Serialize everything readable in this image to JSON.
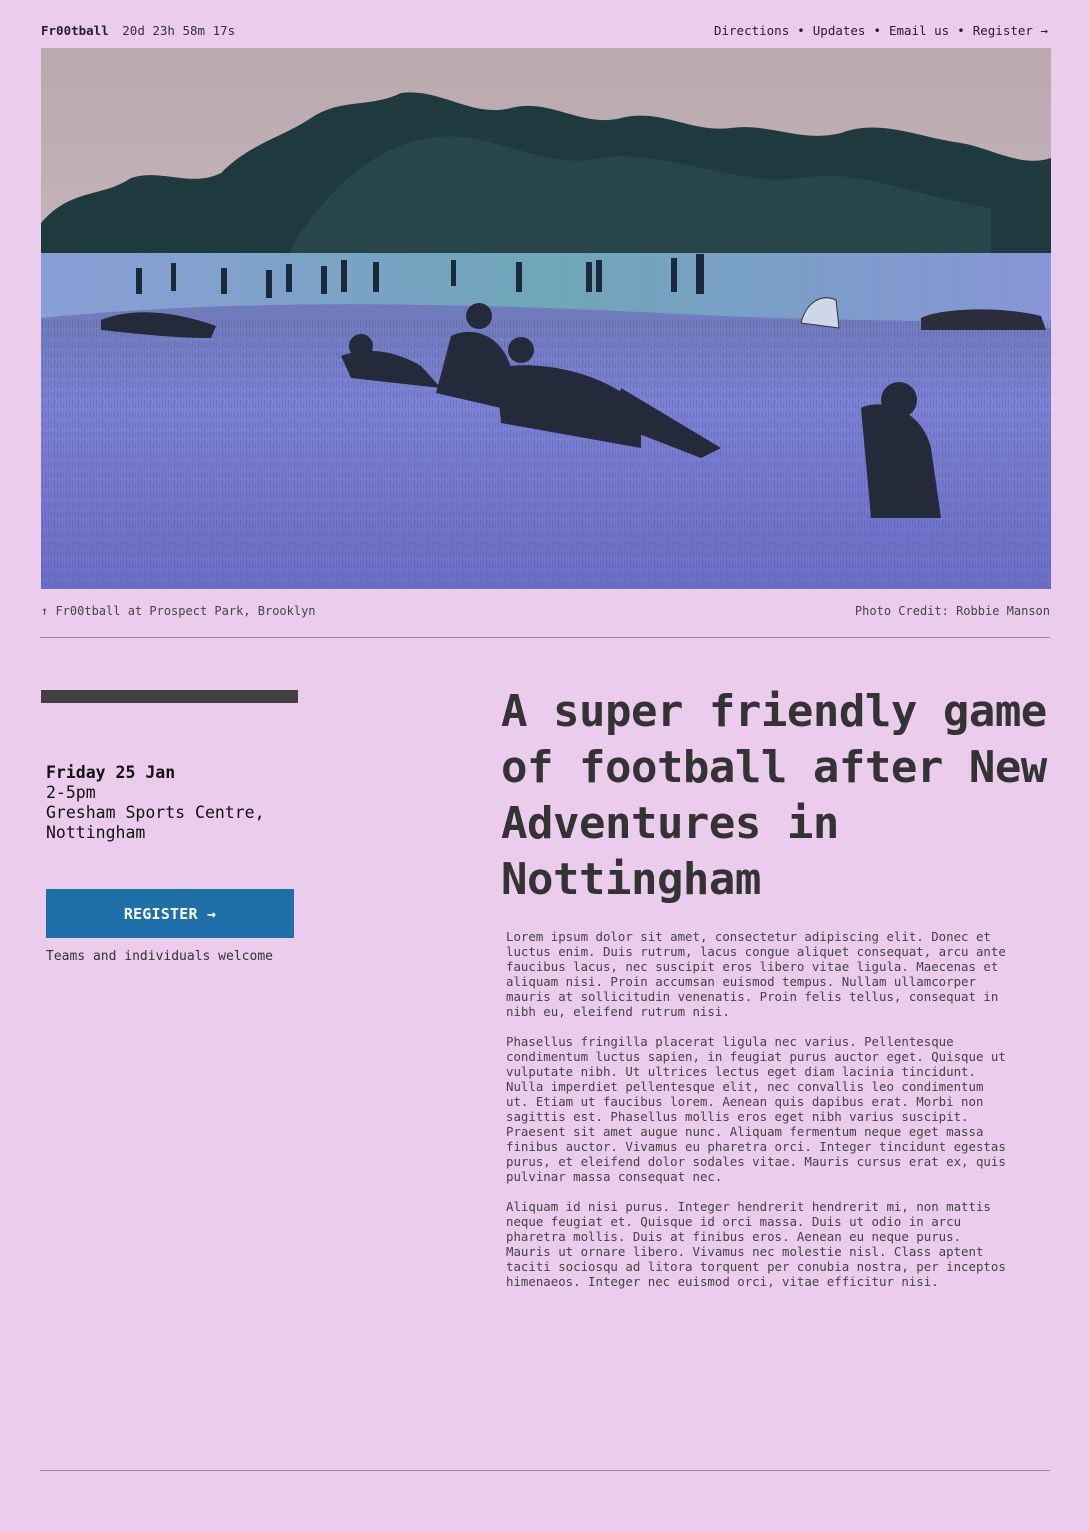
{
  "header": {
    "brand": "Fr00tball",
    "countdown": "20d 23h 58m 17s",
    "nav": [
      "Directions",
      "Updates",
      "Email us",
      "Register →"
    ],
    "separator": "•"
  },
  "hero": {
    "caption": "↑ Fr00tball at Prospect Park, Brooklyn",
    "credit": "Photo Credit: Robbie Manson"
  },
  "event": {
    "date": "Friday 25 Jan",
    "time": "2-5pm",
    "venue_line1": "Gresham Sports Centre,",
    "venue_line2": "Nottingham",
    "register_label": "REGISTER →",
    "note": "Teams and individuals welcome"
  },
  "article": {
    "headline": "A super friendly game of football after New Adventures in Nottingham",
    "paragraphs": [
      "Lorem ipsum dolor sit amet, consectetur adipiscing elit. Donec et luctus enim. Duis rutrum, lacus congue aliquet consequat, arcu ante faucibus lacus, nec suscipit eros libero vitae ligula. Maecenas et aliquam nisi. Proin accumsan euismod tempus. Nullam ullamcorper mauris at sollicitudin venenatis. Proin felis tellus, consequat in nibh eu, eleifend rutrum nisi.",
      "Phasellus fringilla placerat ligula nec varius. Pellentesque condimentum luctus sapien, in feugiat purus auctor eget. Quisque ut vulputate nibh. Ut ultrices lectus eget diam lacinia tincidunt. Nulla imperdiet pellentesque elit, nec convallis leo condimentum ut. Etiam ut faucibus lorem. Aenean quis dapibus erat. Morbi non sagittis est. Phasellus mollis eros eget nibh varius suscipit. Praesent sit amet augue nunc. Aliquam fermentum neque eget massa finibus auctor. Vivamus eu pharetra orci. Integer tincidunt egestas purus, et eleifend dolor sodales vitae. Mauris cursus erat ex, quis pulvinar massa consequat nec.",
      "Aliquam id nisi purus. Integer hendrerit hendrerit mi, non mattis neque feugiat et. Quisque id orci massa. Duis ut odio in arcu pharetra mollis. Duis at finibus eros. Aenean eu neque purus. Mauris ut ornare libero. Vivamus nec molestie nisl. Class aptent taciti sociosqu ad litora torquent per conubia nostra, per inceptos himenaeos. Integer nec euismod orci, vitae efficitur nisi."
    ]
  },
  "colors": {
    "background": "#ecccec",
    "accent_bar": "#414141",
    "button": "#1f6fa8",
    "text": "#333333"
  }
}
